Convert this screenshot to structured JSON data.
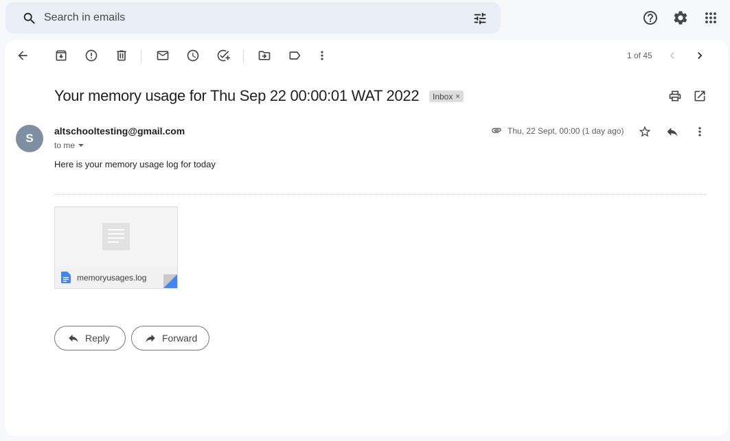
{
  "search": {
    "placeholder": "Search in emails"
  },
  "toolbar": {
    "pager": "1 of 45"
  },
  "email": {
    "subject": "Your memory usage for Thu Sep 22 00:00:01 WAT 2022",
    "label": "Inbox",
    "label_close": "×",
    "avatar_initial": "S",
    "sender": "altschooltesting@gmail.com",
    "recipient": "to me",
    "date": "Thu, 22 Sept, 00:00 (1 day ago)",
    "body": "Here is your memory usage log for today"
  },
  "attachment": {
    "filename": "memoryusages.log"
  },
  "actions": {
    "reply": "Reply",
    "forward": "Forward"
  },
  "colors": {
    "avatar": "#7d8fa1",
    "search_bg": "#e9eef6",
    "file_icon": "#4285f4"
  }
}
